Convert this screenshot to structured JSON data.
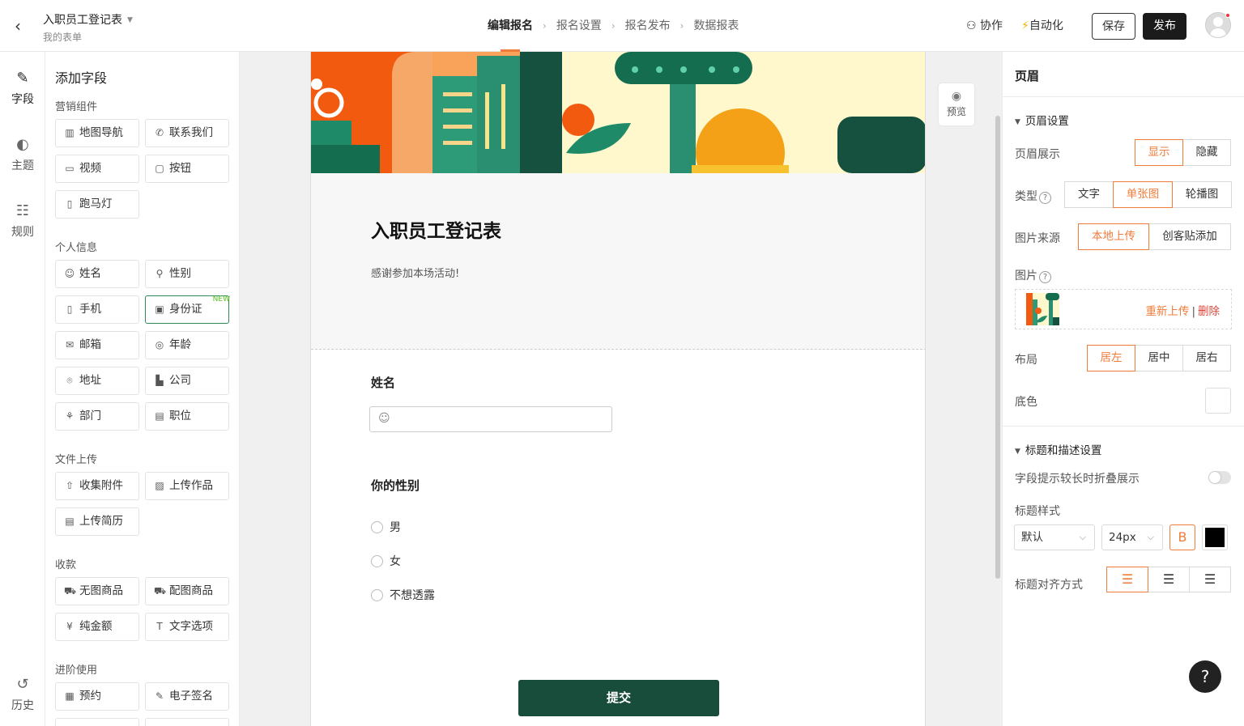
{
  "header": {
    "back_icon": "chevron-left-icon",
    "title": "入职员工登记表",
    "subtitle": "我的表单",
    "steps": [
      "编辑报名",
      "报名设置",
      "报名发布",
      "数据报表"
    ],
    "collab_label": "协作",
    "auto_label": "自动化",
    "save_label": "保存",
    "publish_label": "发布"
  },
  "rail": {
    "items": [
      {
        "label": "字段",
        "icon": "edit-icon"
      },
      {
        "label": "主题",
        "icon": "palette-icon"
      },
      {
        "label": "规则",
        "icon": "rules-icon"
      },
      {
        "label": "历史",
        "icon": "history-icon"
      }
    ]
  },
  "fields": {
    "title": "添加字段",
    "groups": [
      {
        "name": "营销组件",
        "items": [
          "地图导航",
          "联系我们",
          "视频",
          "按钮",
          "跑马灯"
        ]
      },
      {
        "name": "个人信息",
        "items": [
          "姓名",
          "性别",
          "手机",
          "身份证",
          "邮箱",
          "年龄",
          "地址",
          "公司",
          "部门",
          "职位"
        ]
      },
      {
        "name": "文件上传",
        "items": [
          "收集附件",
          "上传作品",
          "上传简历"
        ]
      },
      {
        "name": "收款",
        "items": [
          "无图商品",
          "配图商品",
          "纯金额",
          "文字选项"
        ]
      },
      {
        "name": "进阶使用",
        "items": [
          "预约",
          "电子签名"
        ]
      }
    ],
    "new_badge": "NEW"
  },
  "form": {
    "title": "入职员工登记表",
    "description": "感谢参加本场活动!",
    "q1_label": "姓名",
    "q2_label": "你的性别",
    "q2_options": [
      "男",
      "女",
      "不想透露"
    ],
    "submit_label": "提交",
    "preview_label": "预览"
  },
  "settings": {
    "title": "页眉",
    "section1": "页眉设置",
    "display_label": "页眉展示",
    "display_options": [
      "显示",
      "隐藏"
    ],
    "type_label": "类型",
    "type_options": [
      "文字",
      "单张图",
      "轮播图"
    ],
    "source_label": "图片来源",
    "source_options": [
      "本地上传",
      "创客贴添加"
    ],
    "image_label": "图片",
    "reupload": "重新上传",
    "divider": "|",
    "delete": "删除",
    "layout_label": "布局",
    "layout_options": [
      "居左",
      "居中",
      "居右"
    ],
    "bg_label": "底色",
    "section2": "标题和描述设置",
    "fold_label": "字段提示较长时折叠展示",
    "title_style_label": "标题样式",
    "font_select": "默认",
    "size_select": "24px",
    "bold_glyph": "B",
    "align_label": "标题对齐方式",
    "help_glyph": "?"
  },
  "colors": {
    "accent": "#f07c3c",
    "submit": "#174d3a",
    "title_color": "#000000"
  }
}
